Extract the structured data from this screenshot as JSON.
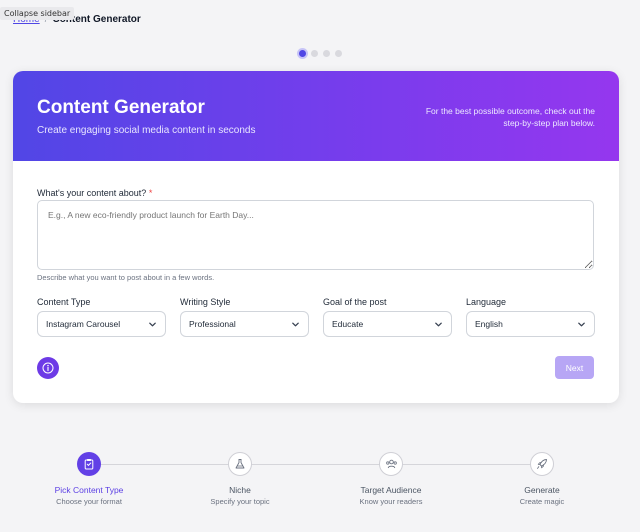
{
  "tooltip": "Collapse sidebar",
  "breadcrumb": {
    "home": "Home",
    "separator": "/",
    "current": "Content Generator"
  },
  "carousel": {
    "count": 4,
    "active": 1
  },
  "hero": {
    "title": "Content Generator",
    "subtitle": "Create engaging social media content in seconds",
    "note": "For the best possible outcome, check out the step-by-step plan below."
  },
  "form": {
    "question_label": "What's your content about?",
    "required_mark": "*",
    "placeholder": "E.g., A new eco-friendly product launch for Earth Day...",
    "help": "Describe what you want to post about in a few words.",
    "fields": [
      {
        "label": "Content Type",
        "value": "Instagram Carousel"
      },
      {
        "label": "Writing Style",
        "value": "Professional"
      },
      {
        "label": "Goal of the post",
        "value": "Educate"
      },
      {
        "label": "Language",
        "value": "English"
      }
    ],
    "next_label": "Next"
  },
  "steps": [
    {
      "title": "Pick Content Type",
      "subtitle": "Choose your format",
      "icon": "clipboard-icon",
      "active": true
    },
    {
      "title": "Niche",
      "subtitle": "Specify your topic",
      "icon": "flask-icon",
      "active": false
    },
    {
      "title": "Target Audience",
      "subtitle": "Know your readers",
      "icon": "users-icon",
      "active": false
    },
    {
      "title": "Generate",
      "subtitle": "Create magic",
      "icon": "rocket-icon",
      "active": false
    }
  ],
  "colors": {
    "accent": "#5046e5",
    "gradient_start": "#5146e6",
    "gradient_end": "#9537ee",
    "next_button": "#b7a6f5",
    "required": "#ef4444"
  }
}
